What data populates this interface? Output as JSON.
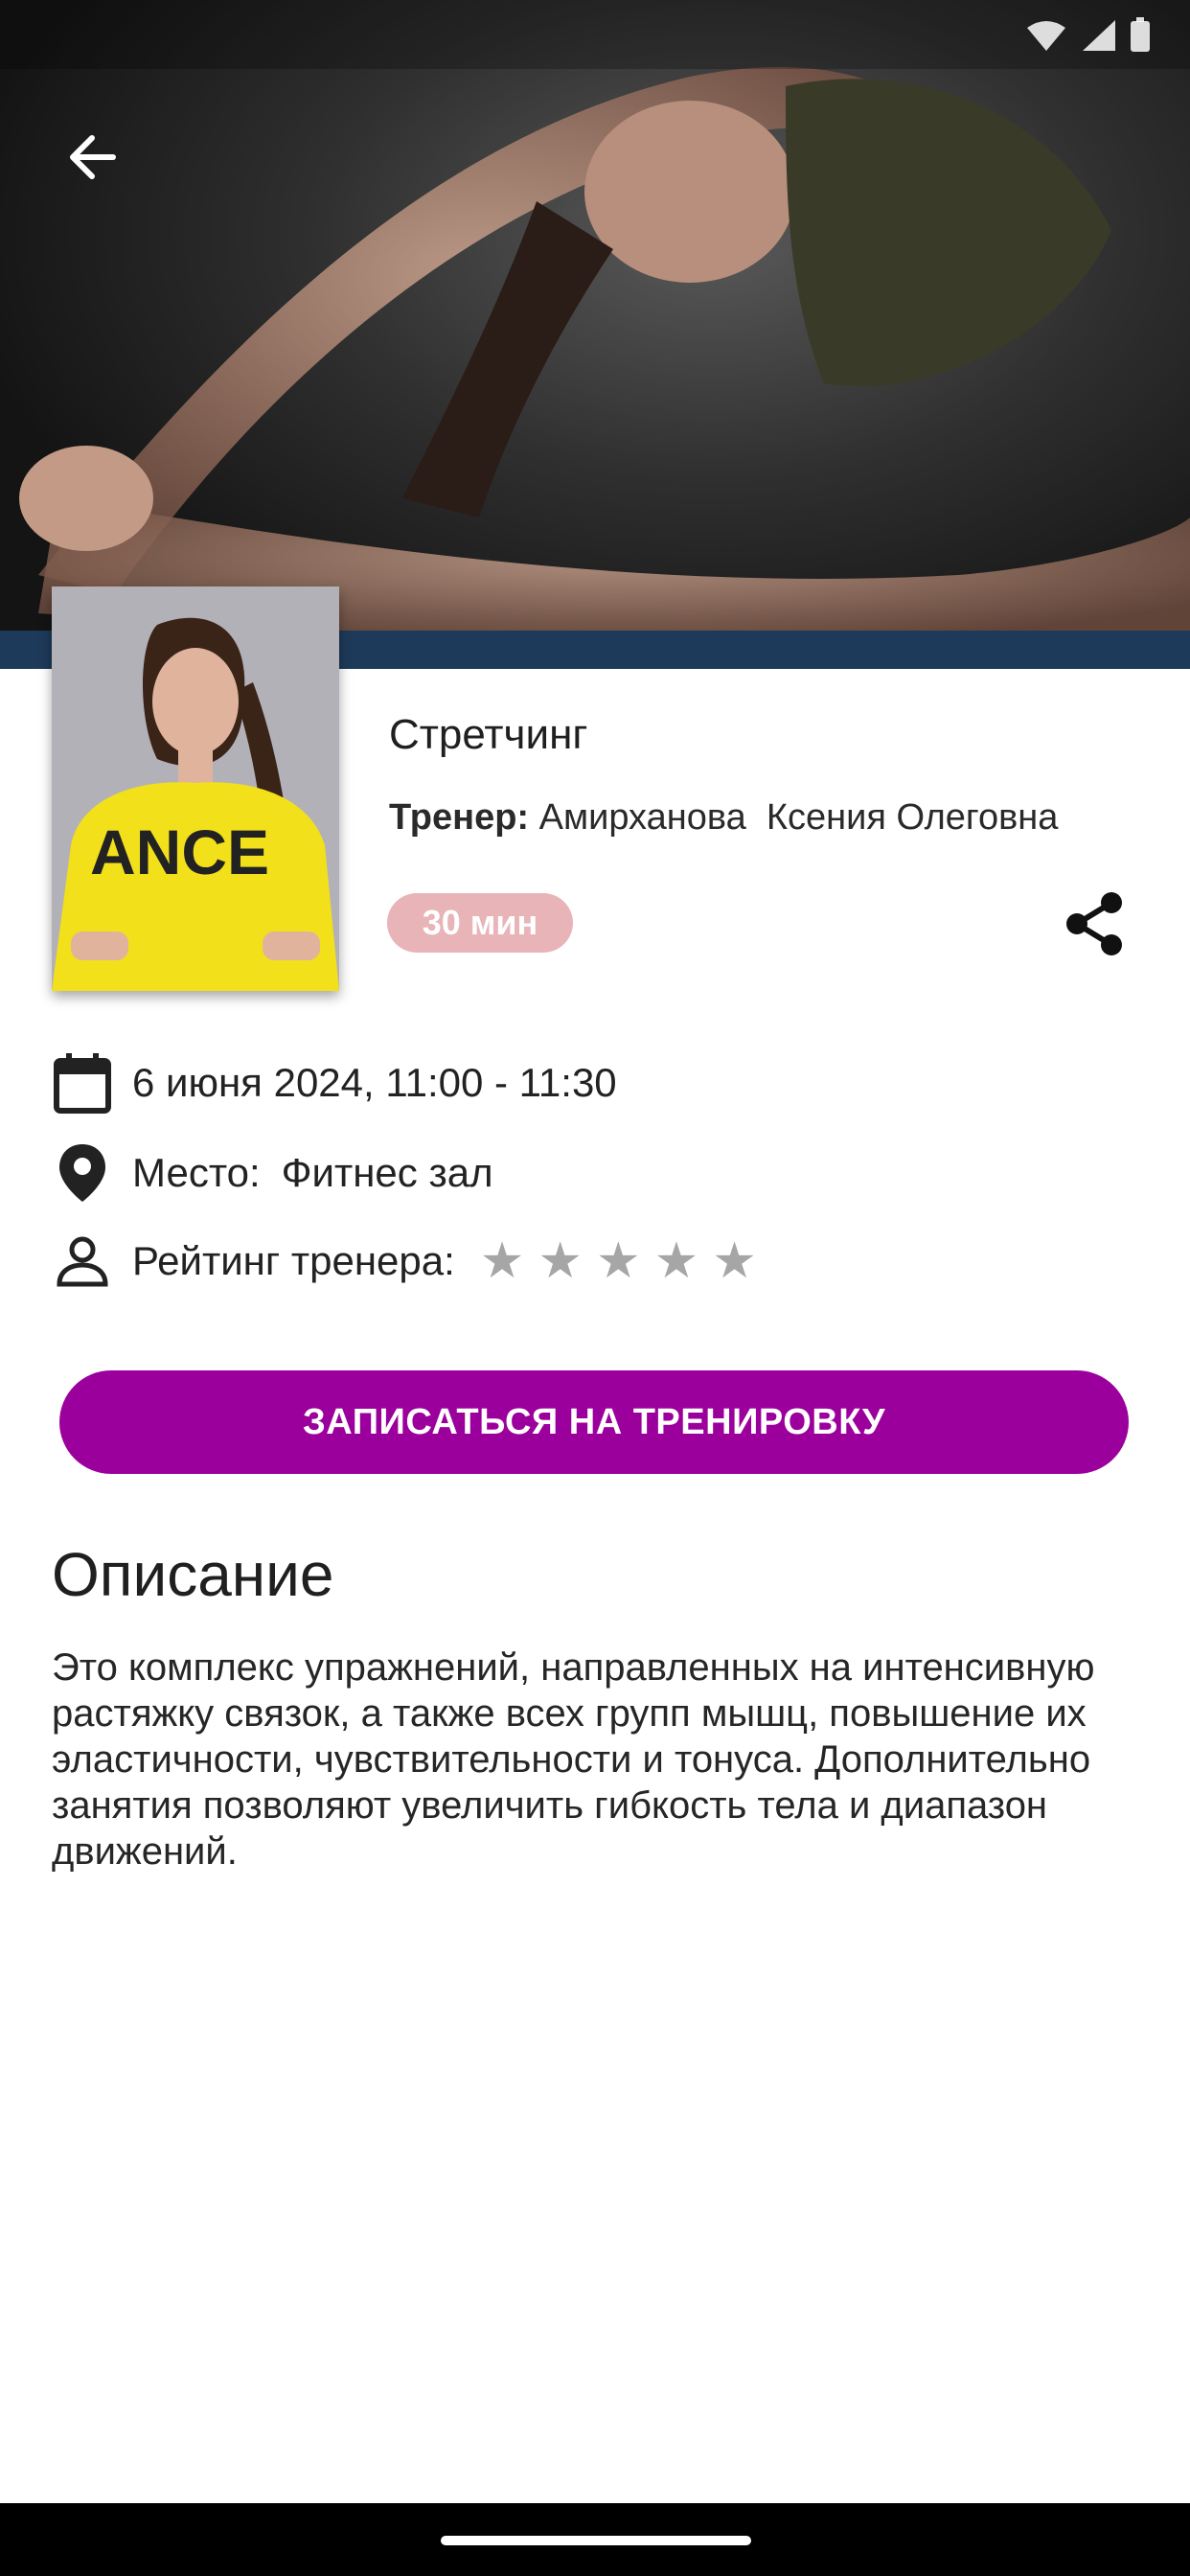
{
  "header": {
    "back_icon": "arrow-left-icon",
    "status_icons": [
      "wifi-icon",
      "signal-icon",
      "battery-icon"
    ]
  },
  "workout": {
    "title": "Стретчинг",
    "trainer_label": "Тренер:",
    "trainer_name": "Амирханова  Ксения Олеговна",
    "duration_badge": "30 мин",
    "badge_color": "#e8b4b8",
    "share_icon": "share-icon"
  },
  "info": {
    "date_text": "6 июня 2024, 11:00 - 11:30",
    "place_label": "Место:",
    "place_value": "Фитнес зал",
    "rating_label": "Рейтинг тренера:",
    "rating_value": 0,
    "rating_max": 5
  },
  "cta": {
    "label": "ЗАПИСАТЬСЯ НА ТРЕНИРОВКУ",
    "color": "#9b009d"
  },
  "description": {
    "title": "Описание",
    "text": "Это комплекс упражнений, направленных на интенсивную растяжку связок, а также всех групп мышц, повышение их эластичности, чувствительности и тонуса. Дополнительно занятия позволяют увеличить гибкость тела и диапазон движений."
  }
}
